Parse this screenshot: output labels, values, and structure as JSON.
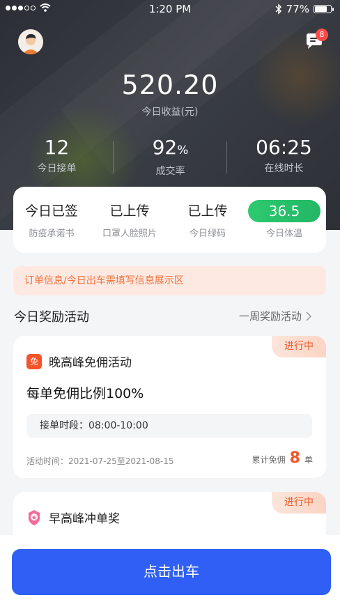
{
  "status_bar": {
    "time": "1:20 PM",
    "battery": "77%",
    "battery_level": 0.77
  },
  "header": {
    "message_badge": "8"
  },
  "income": {
    "value": "520.20",
    "label": "今日收益(元)"
  },
  "stats": [
    {
      "value": "12",
      "unit": "",
      "label": "今日接单"
    },
    {
      "value": "92",
      "unit": "%",
      "label": "成交率"
    },
    {
      "value": "06:25",
      "unit": "",
      "label": "在线时长"
    }
  ],
  "health": [
    {
      "value": "今日已签",
      "label": "防疫承诺书"
    },
    {
      "value": "已上传",
      "label": "口罩人脸照片"
    },
    {
      "value": "已上传",
      "label": "今日绿码"
    },
    {
      "value": "36.5",
      "label": "今日体温"
    }
  ],
  "notice": {
    "text": "订单信息/今日出车需填写信息展示区"
  },
  "rewards": {
    "title": "今日奖励活动",
    "link": "一周奖励活动"
  },
  "activities": [
    {
      "status": "进行中",
      "icon_text": "免",
      "name": "晚高峰免佣活动",
      "desc": "每单免佣比例100%",
      "time_range": "接单时段：08:00-10:00",
      "period": "活动时间：2021-07-25至2021-08-15",
      "free_label": "累计免佣",
      "free_count": "8",
      "free_unit": "单"
    },
    {
      "status": "进行中",
      "name": "早高峰冲单奖"
    }
  ],
  "primary_action": {
    "label": "点击出车"
  },
  "colors": {
    "primary": "#2f5ff5",
    "accent": "#f5532a",
    "green": "#22b765",
    "hero": "#2b2e34"
  }
}
